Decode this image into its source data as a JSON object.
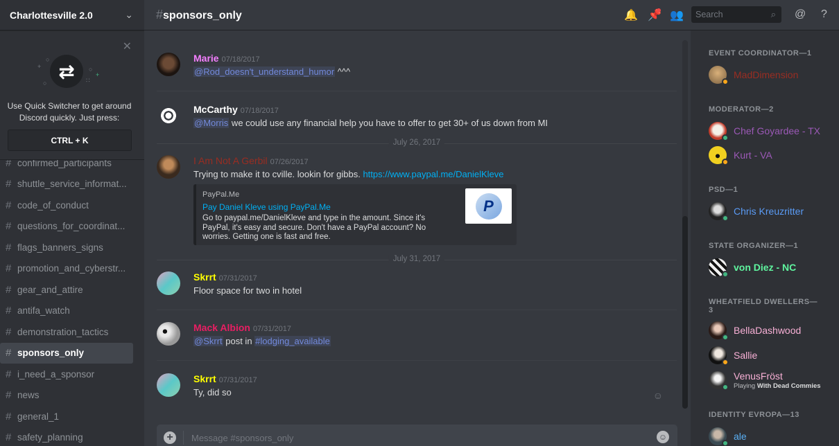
{
  "server": {
    "name": "Charlottesville 2.0"
  },
  "quick_switcher": {
    "line1": "Use Quick Switcher to get around",
    "line2": "Discord quickly. Just press:",
    "shortcut": "CTRL + K"
  },
  "channels": [
    {
      "name": "confirmed_participants"
    },
    {
      "name": "shuttle_service_informat..."
    },
    {
      "name": "code_of_conduct"
    },
    {
      "name": "questions_for_coordinat..."
    },
    {
      "name": "flags_banners_signs"
    },
    {
      "name": "promotion_and_cyberstr..."
    },
    {
      "name": "gear_and_attire"
    },
    {
      "name": "antifa_watch"
    },
    {
      "name": "demonstration_tactics"
    },
    {
      "name": "sponsors_only"
    },
    {
      "name": "i_need_a_sponsor"
    },
    {
      "name": "news"
    },
    {
      "name": "general_1"
    },
    {
      "name": "safety_planning"
    }
  ],
  "header": {
    "hash": "#",
    "channel": "sponsors_only",
    "search_placeholder": "Search"
  },
  "messages": [
    {
      "author": "Marie",
      "author_color": "#f47fff",
      "timestamp": "07/18/2017",
      "mention": "@Rod_doesn't_understand_humor",
      "text": " ^^^"
    },
    {
      "author": "McCarthy",
      "author_color": "#ffffff",
      "timestamp": "07/18/2017",
      "mention": "@Morris",
      "text": " we could use any financial help you have to offer to get 30+ of us down from MI"
    },
    {
      "author": "I Am Not A Gerbil",
      "author_color": "#992d22",
      "timestamp": "07/26/2017",
      "text": "Trying to make it to cville. lookin for gibbs. ",
      "link": "https://www.paypal.me/DanielKleve"
    },
    {
      "author": "Skrrt",
      "author_color": "#ffff00",
      "timestamp": "07/31/2017",
      "text": "Floor space for two in hotel"
    },
    {
      "author": "Mack Albion",
      "author_color": "#e91e63",
      "timestamp": "07/31/2017",
      "mention": "@Skrrt",
      "text": " post in ",
      "mention2": "#lodging_available"
    },
    {
      "author": "Skrrt",
      "author_color": "#ffff00",
      "timestamp": "07/31/2017",
      "text": "Ty, did so"
    }
  ],
  "date_separators": [
    "July 26, 2017",
    "July 31, 2017"
  ],
  "embed": {
    "provider": "PayPal.Me",
    "title": "Pay Daniel Kleve using PayPal.Me",
    "description": "Go to paypal.me/DanielKleve and type in the amount. Since it's PayPal, it's easy and secure. Don't have a PayPal account? No worries. Getting one is fast and free.",
    "thumb_letter": "P"
  },
  "composer": {
    "placeholder": "Message #sponsors_only"
  },
  "member_groups": [
    {
      "label": "EVENT COORDINATOR—1",
      "members": [
        {
          "name": "MadDimension",
          "color": "#992d22",
          "status": "idle"
        }
      ]
    },
    {
      "label": "MODERATOR—2",
      "members": [
        {
          "name": "Chef Goyardee - TX",
          "color": "#9b59b6",
          "status": "online"
        },
        {
          "name": "Kurt - VA",
          "color": "#9b59b6",
          "status": "idle"
        }
      ]
    },
    {
      "label": "PSD—1",
      "members": [
        {
          "name": "Chris Kreuzritter",
          "color": "#5a9bf5",
          "status": "online"
        }
      ]
    },
    {
      "label": "STATE ORGANIZER—1",
      "members": [
        {
          "name": "von Diez - NC",
          "color": "#5ff59f",
          "status": "online"
        }
      ]
    },
    {
      "label": "WHEATFIELD DWELLERS—3",
      "members": [
        {
          "name": "BellaDashwood",
          "color": "#f8b0d6",
          "status": "online"
        },
        {
          "name": "Sallie",
          "color": "#f8b0d6",
          "status": "idle"
        },
        {
          "name": "VenusFröst",
          "color": "#f8b0d6",
          "status": "online",
          "activity_prefix": "Playing ",
          "activity": "With Dead Commies"
        }
      ]
    },
    {
      "label": "IDENTITY EVROPA—13",
      "members": [
        {
          "name": "ale",
          "color": "#5ab0f5",
          "status": "online"
        }
      ]
    }
  ],
  "colors": {
    "online": "#43b581",
    "idle": "#faa61a",
    "accent": "#7289da"
  }
}
